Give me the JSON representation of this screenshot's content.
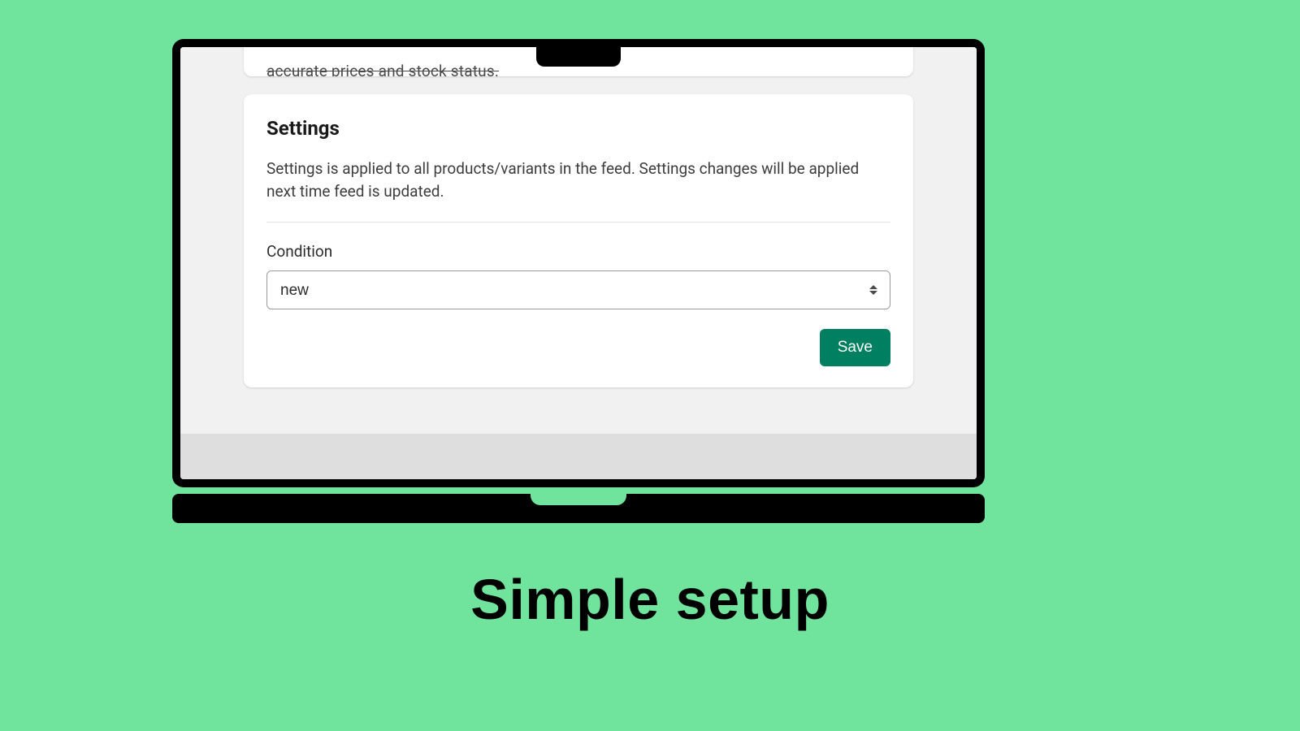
{
  "top_card": {
    "partial_text": "accurate prices and stock status."
  },
  "settings": {
    "title": "Settings",
    "description": "Settings is applied to all products/variants in the feed. Settings changes will be applied next time feed is updated.",
    "condition_label": "Condition",
    "condition_value": "new",
    "save_label": "Save"
  },
  "caption": "Simple setup",
  "colors": {
    "page_bg": "#70e39d",
    "primary_button": "#008060"
  }
}
